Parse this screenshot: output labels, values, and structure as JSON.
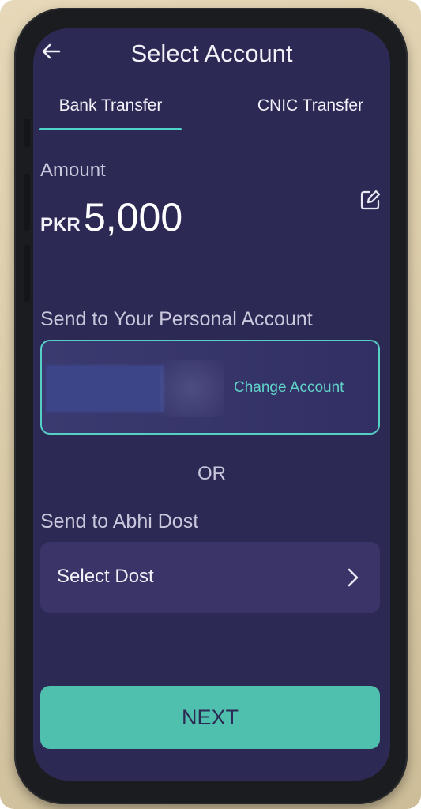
{
  "header": {
    "title": "Select Account"
  },
  "tabs": [
    {
      "label": "Bank Transfer",
      "active": true
    },
    {
      "label": "CNIC Transfer",
      "active": false
    }
  ],
  "amount": {
    "label": "Amount",
    "currency": "PKR",
    "value": "5,000"
  },
  "personal_account": {
    "label": "Send to Your Personal Account",
    "change_label": "Change Account"
  },
  "separator": "OR",
  "abhi_dost": {
    "label": "Send to Abhi Dost",
    "select_label": "Select Dost"
  },
  "next_button": "NEXT",
  "colors": {
    "screen_bg": "#2c2a55",
    "accent": "#4fbfae",
    "card_border": "#56cfc5"
  },
  "icons": {
    "back": "arrow-left-icon",
    "edit": "edit-icon",
    "chevron": "chevron-right-icon"
  }
}
